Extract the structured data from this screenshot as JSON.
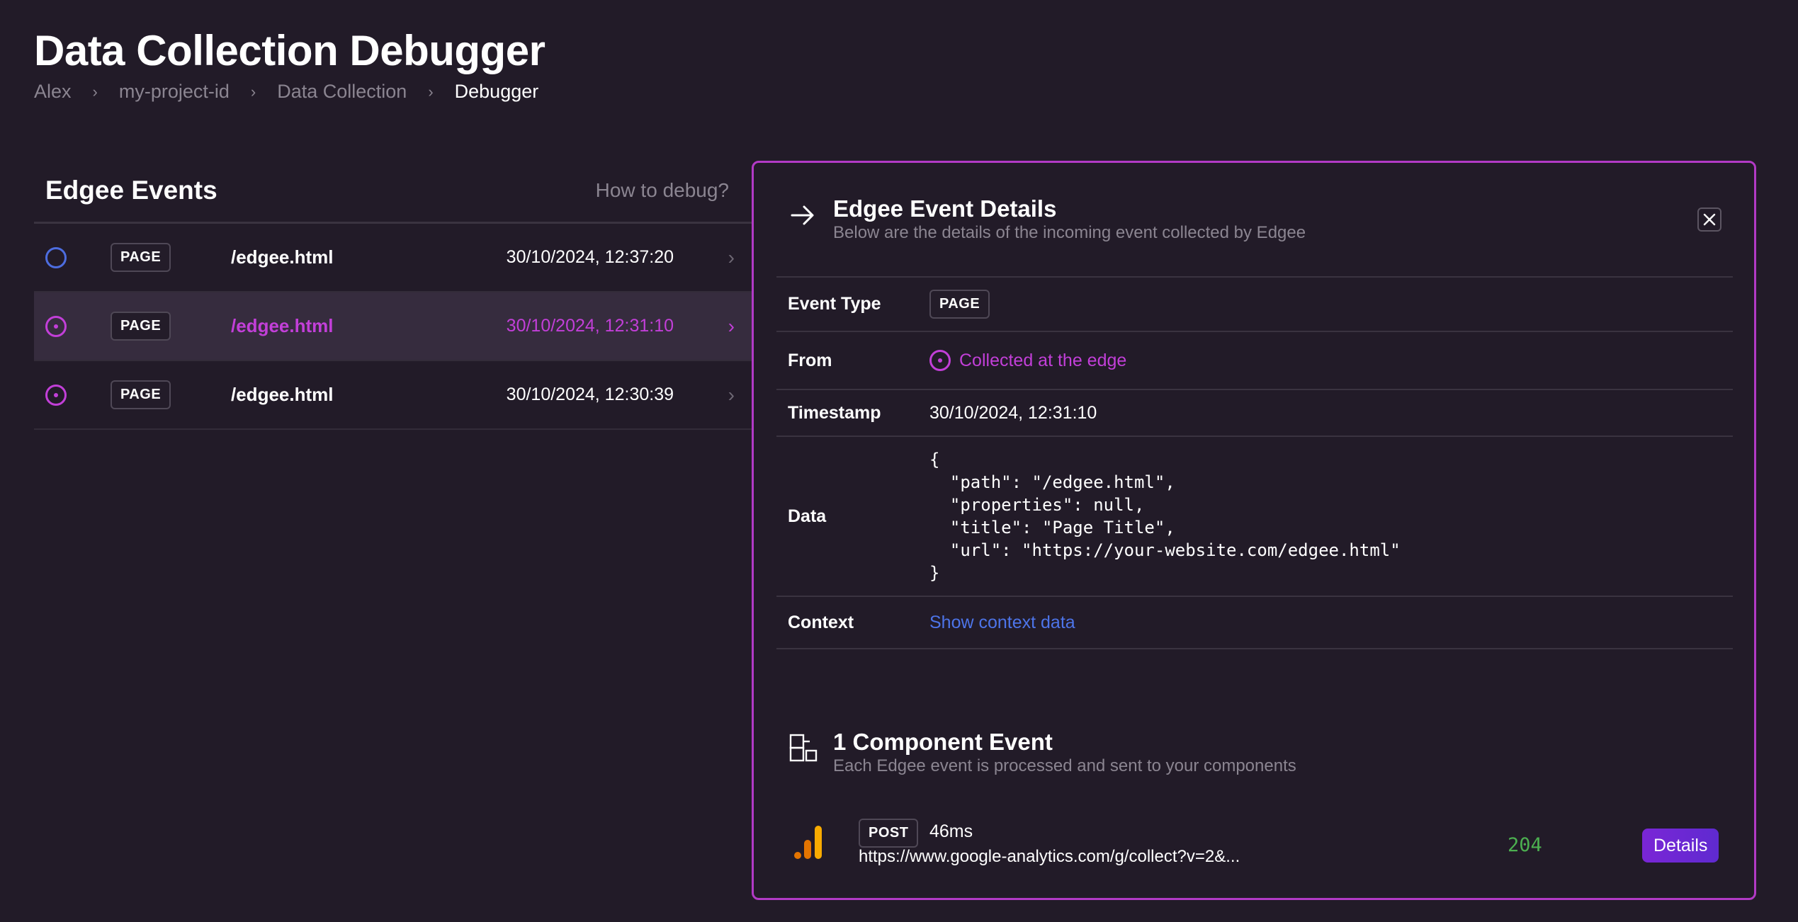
{
  "page": {
    "title": "Data Collection Debugger",
    "breadcrumb": [
      "Alex",
      "my-project-id",
      "Data Collection",
      "Debugger"
    ]
  },
  "events_panel": {
    "title": "Edgee Events",
    "help_link": "How to debug?",
    "events": [
      {
        "icon": "circle-outline-icon",
        "type": "PAGE",
        "path": "/edgee.html",
        "timestamp": "30/10/2024, 12:37:20",
        "selected": false
      },
      {
        "icon": "edge-dot-icon",
        "type": "PAGE",
        "path": "/edgee.html",
        "timestamp": "30/10/2024, 12:31:10",
        "selected": true
      },
      {
        "icon": "edge-dot-icon",
        "type": "PAGE",
        "path": "/edgee.html",
        "timestamp": "30/10/2024, 12:30:39",
        "selected": false
      }
    ]
  },
  "details": {
    "title": "Edgee Event Details",
    "subtitle": "Below are the details of the incoming event collected by Edgee",
    "fields": {
      "event_type_label": "Event Type",
      "event_type": "PAGE",
      "from_label": "From",
      "from": "Collected at the edge",
      "timestamp_label": "Timestamp",
      "timestamp": "30/10/2024, 12:31:10",
      "data_label": "Data",
      "data_json": "{\n  \"path\": \"/edgee.html\",\n  \"properties\": null,\n  \"title\": \"Page Title\",\n  \"url\": \"https://your-website.com/edgee.html\"\n}",
      "context_label": "Context",
      "context_link": "Show context data"
    }
  },
  "components": {
    "title": "1 Component Event",
    "subtitle": "Each Edgee event is processed and sent to your components",
    "items": [
      {
        "icon": "google-analytics-icon",
        "method": "POST",
        "duration": "46ms",
        "url": "https://www.google-analytics.com/g/collect?v=2&...",
        "status": "204",
        "button": "Details"
      }
    ]
  },
  "colors": {
    "background": "#221b28",
    "accent": "#c23fd8",
    "link": "#4d74e8",
    "success": "#4caf50",
    "button": "#7a26d6"
  }
}
